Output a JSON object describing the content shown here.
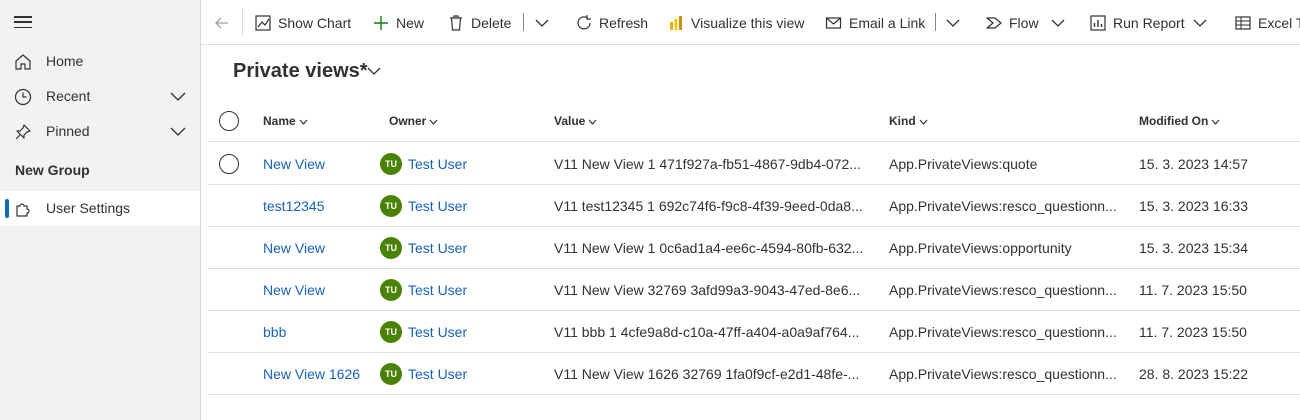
{
  "commands": {
    "show_chart": "Show Chart",
    "new": "New",
    "delete": "Delete",
    "refresh": "Refresh",
    "visualize": "Visualize this view",
    "email_link": "Email a Link",
    "flow": "Flow",
    "run_report": "Run Report",
    "excel": "Excel Te"
  },
  "sidebar": {
    "items": [
      {
        "label": "Home"
      },
      {
        "label": "Recent"
      },
      {
        "label": "Pinned"
      }
    ],
    "group_title": "New Group",
    "group_items": [
      {
        "label": "User Settings"
      }
    ]
  },
  "view": {
    "title": "Private views*"
  },
  "columns": {
    "name": "Name",
    "owner": "Owner",
    "value": "Value",
    "kind": "Kind",
    "modified": "Modified On"
  },
  "rows": [
    {
      "name": "New View",
      "owner_initials": "TU",
      "owner": "Test User",
      "value": "V11 New View 1 471f927a-fb51-4867-9db4-072...",
      "kind": "App.PrivateViews:quote",
      "modified": "15. 3. 2023 14:57"
    },
    {
      "name": "test12345",
      "owner_initials": "TU",
      "owner": "Test User",
      "value": "V11 test12345 1 692c74f6-f9c8-4f39-9eed-0da8...",
      "kind": "App.PrivateViews:resco_questionn...",
      "modified": "15. 3. 2023 16:33"
    },
    {
      "name": "New View",
      "owner_initials": "TU",
      "owner": "Test User",
      "value": "V11 New View 1 0c6ad1a4-ee6c-4594-80fb-632...",
      "kind": "App.PrivateViews:opportunity",
      "modified": "15. 3. 2023 15:34"
    },
    {
      "name": "New View",
      "owner_initials": "TU",
      "owner": "Test User",
      "value": "V11 New View 32769 3afd99a3-9043-47ed-8e6...",
      "kind": "App.PrivateViews:resco_questionn...",
      "modified": "11. 7. 2023 15:50"
    },
    {
      "name": "bbb",
      "owner_initials": "TU",
      "owner": "Test User",
      "value": "V11 bbb 1 4cfe9a8d-c10a-47ff-a404-a0a9af764...",
      "kind": "App.PrivateViews:resco_questionn...",
      "modified": "11. 7. 2023 15:50"
    },
    {
      "name": "New View 1626",
      "owner_initials": "TU",
      "owner": "Test User",
      "value": "V11 New View 1626 32769 1fa0f9cf-e2d1-48fe-...",
      "kind": "App.PrivateViews:resco_questionn...",
      "modified": "28. 8. 2023 15:22"
    }
  ],
  "colors": {
    "accent": "#0f6cbd",
    "link": "#1763b8",
    "avatar": "#498205"
  }
}
